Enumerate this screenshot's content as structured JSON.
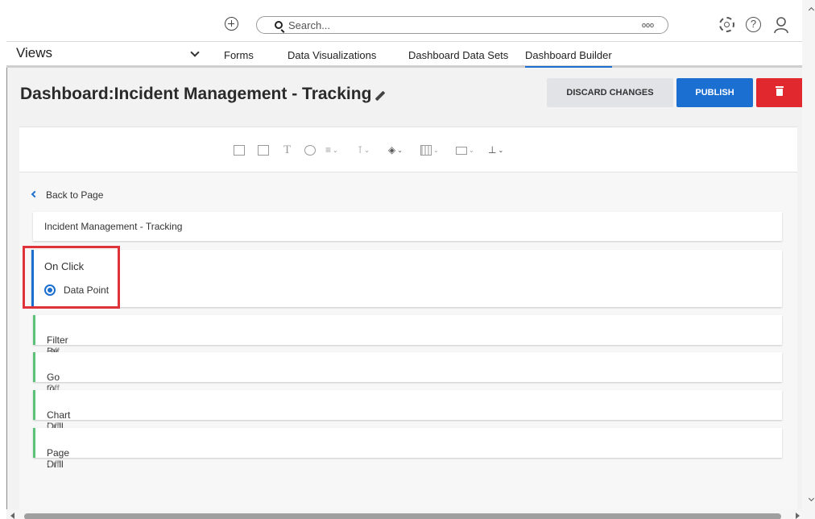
{
  "header": {
    "search_placeholder": "Search...",
    "more_label": "ooo"
  },
  "nav": {
    "views_label": "Views",
    "tabs": [
      {
        "label": "Forms"
      },
      {
        "label": "Data Visualizations"
      },
      {
        "label": "Dashboard Data Sets"
      },
      {
        "label": "Dashboard Builder",
        "active": true
      }
    ]
  },
  "page": {
    "title": "Dashboard:Incident Management - Tracking",
    "discard_label": "DISCARD CHANGES",
    "publish_label": "PUBLISH"
  },
  "toolbar": {
    "tools": [
      "chart-icon",
      "image-icon",
      "text-icon",
      "gauge-icon",
      "filter-icon",
      "align-icon",
      "layers-icon",
      "grid-icon",
      "layout-icon",
      "export-icon"
    ],
    "text_tool_label": "T"
  },
  "panel": {
    "back_label": "Back to Page",
    "visualization_title": "Incident Management - Tracking",
    "on_click_label": "On Click",
    "radio_option_label": "Data Point",
    "actions": [
      {
        "label": "Filter By",
        "state": "- Off"
      },
      {
        "label": "Go to URL",
        "state": "- Off"
      },
      {
        "label": "Chart Drill Down",
        "state": "- Off"
      },
      {
        "label": "Page Drill",
        "state": "- Off"
      }
    ]
  },
  "colors": {
    "accent": "#1a6fd1",
    "danger": "#e0282e",
    "action_border": "#5cc27a",
    "highlight": "#e0323a"
  }
}
